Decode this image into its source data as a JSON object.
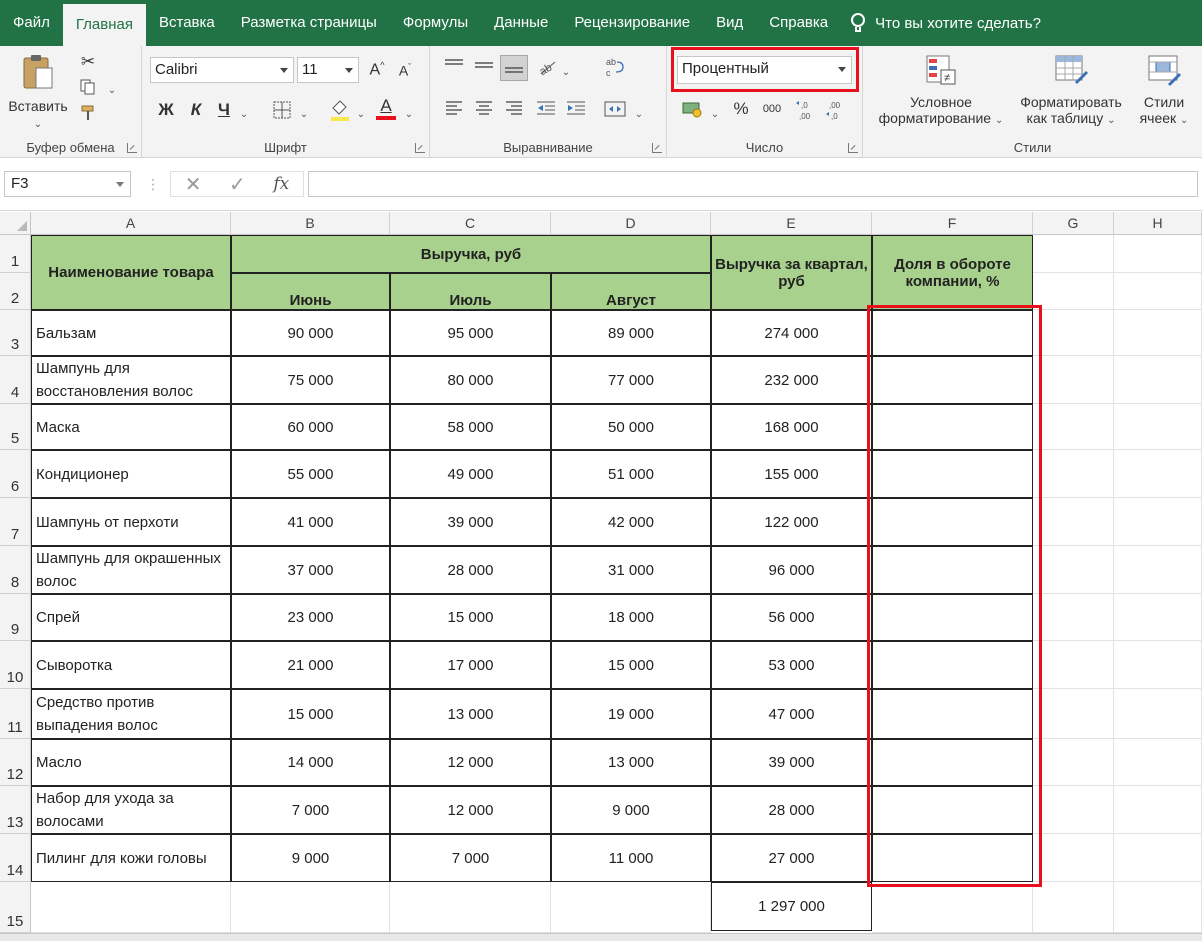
{
  "menu": {
    "tabs": [
      "Файл",
      "Главная",
      "Вставка",
      "Разметка страницы",
      "Формулы",
      "Данные",
      "Рецензирование",
      "Вид",
      "Справка"
    ],
    "active_tab": "Главная",
    "tell_me": "Что вы хотите сделать?"
  },
  "ribbon": {
    "clipboard": {
      "paste": "Вставить",
      "label": "Буфер обмена"
    },
    "font": {
      "name": "Calibri",
      "size": "11",
      "bold": "Ж",
      "italic": "К",
      "underline": "Ч",
      "font_color_letter": "A",
      "grow": "A",
      "shrink": "A",
      "label": "Шрифт"
    },
    "alignment": {
      "label": "Выравнивание"
    },
    "number": {
      "format": "Процентный",
      "percent": "%",
      "thousands": "000",
      "label": "Число"
    },
    "styles": {
      "conditional": [
        "Условное",
        "форматирование"
      ],
      "table": [
        "Форматировать",
        "как таблицу"
      ],
      "cell": [
        "Стили",
        "ячеек"
      ],
      "label": "Стили"
    }
  },
  "formula_bar": {
    "name_box": "F3",
    "cancel": "✕",
    "enter": "✓",
    "fx": "fx",
    "value": ""
  },
  "columns": [
    "A",
    "B",
    "C",
    "D",
    "E",
    "F",
    "G",
    "H"
  ],
  "table": {
    "h_name": "Наименование товара",
    "h_revenue": "Выручка, руб",
    "h_june": "Июнь",
    "h_july": "Июль",
    "h_august": "Август",
    "h_quarter": "Выручка за квартал, руб",
    "h_share": "Доля в обороте компании, %",
    "rows": [
      {
        "num": "3",
        "name": "Бальзам",
        "jun": "90 000",
        "jul": "95 000",
        "aug": "89 000",
        "q": "274 000"
      },
      {
        "num": "4",
        "name": "Шампунь для восстановления волос",
        "jun": "75 000",
        "jul": "80 000",
        "aug": "77 000",
        "q": "232 000"
      },
      {
        "num": "5",
        "name": "Маска",
        "jun": "60 000",
        "jul": "58 000",
        "aug": "50 000",
        "q": "168 000"
      },
      {
        "num": "6",
        "name": "Кондиционер",
        "jun": "55 000",
        "jul": "49 000",
        "aug": "51 000",
        "q": "155 000"
      },
      {
        "num": "7",
        "name": "Шампунь от перхоти",
        "jun": "41 000",
        "jul": "39 000",
        "aug": "42 000",
        "q": "122 000"
      },
      {
        "num": "8",
        "name": "Шампунь для окрашенных волос",
        "jun": "37 000",
        "jul": "28 000",
        "aug": "31 000",
        "q": "96 000"
      },
      {
        "num": "9",
        "name": "Спрей",
        "jun": "23 000",
        "jul": "15 000",
        "aug": "18 000",
        "q": "56 000"
      },
      {
        "num": "10",
        "name": "Сыворотка",
        "jun": "21 000",
        "jul": "17 000",
        "aug": "15 000",
        "q": "53 000"
      },
      {
        "num": "11",
        "name": "Средство против выпадения волос",
        "jun": "15 000",
        "jul": "13 000",
        "aug": "19 000",
        "q": "47 000"
      },
      {
        "num": "12",
        "name": "Масло",
        "jun": "14 000",
        "jul": "12 000",
        "aug": "13 000",
        "q": "39 000"
      },
      {
        "num": "13",
        "name": "Набор для ухода за волосами",
        "jun": "7 000",
        "jul": "12 000",
        "aug": "9 000",
        "q": "28 000"
      },
      {
        "num": "14",
        "name": "Пилинг для кожи головы",
        "jun": "9 000",
        "jul": "7 000",
        "aug": "11 000",
        "q": "27 000"
      }
    ],
    "total": "1 297 000"
  },
  "row_numbers": [
    "1",
    "2",
    "15"
  ],
  "colors": {
    "ribbon_green": "#217346",
    "header_fill": "#a9d18e",
    "highlight_red": "#e8111b"
  }
}
